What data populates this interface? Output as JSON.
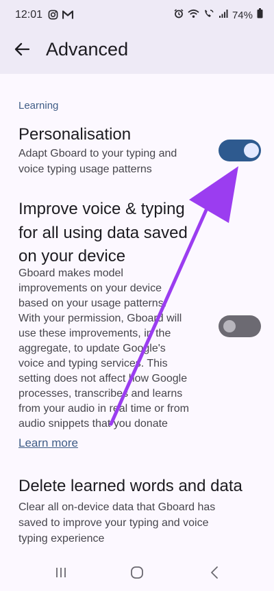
{
  "status_bar": {
    "time": "12:01",
    "battery": "74%",
    "left_icons": [
      "instagram-icon",
      "gmail-icon"
    ],
    "right_icons": [
      "alarm-icon",
      "wifi-icon",
      "wifi-calling-icon",
      "signal-icon",
      "battery-icon"
    ]
  },
  "app_bar": {
    "title": "Advanced",
    "back_icon": "arrow-back-icon"
  },
  "section": {
    "header": "Learning"
  },
  "settings": [
    {
      "title": "Personalisation",
      "description": [
        "Adapt Gboard to your typing and",
        "voice typing usage patterns"
      ],
      "toggle_on": true
    },
    {
      "title": [
        "Improve voice & typing",
        "for all using data saved",
        "on your device"
      ],
      "description": [
        "Gboard makes model",
        "improvements on your device",
        "based on your usage patterns.",
        "With your permission, Gboard will",
        "use these improvements, in the",
        "aggregate, to update Google's",
        "voice and typing services. This",
        "setting does not affect how Google",
        "processes, transcribes and learns",
        "from your audio in real time or from",
        "audio snippets that you donate"
      ],
      "toggle_on": false
    },
    {
      "title": "Delete learned words and data",
      "description": [
        "Clear all on-device data that Gboard has",
        "saved to improve your typing and voice",
        "typing experience"
      ]
    }
  ],
  "learn_more": "Learn more",
  "colors": {
    "accent": "#2e5a8f",
    "link": "#3f5d86",
    "annotation_arrow": "#9b3df0"
  },
  "nav_bar": {
    "icons": [
      "recents-icon",
      "home-icon",
      "back-icon"
    ]
  }
}
